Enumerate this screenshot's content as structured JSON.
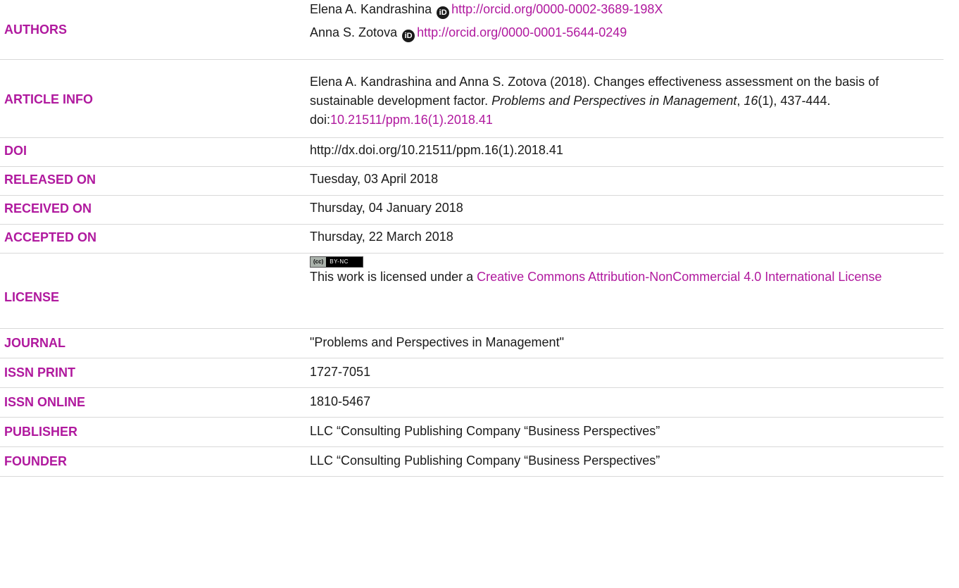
{
  "authors": {
    "label": "AUTHORS",
    "list": [
      {
        "name": "Elena A. Kandrashina",
        "orcid_url": "http://orcid.org/0000-0002-3689-198X"
      },
      {
        "name": "Anna S. Zotova",
        "orcid_url": "http://orcid.org/0000-0001-5644-0249"
      }
    ]
  },
  "article_info": {
    "label": "ARTICLE INFO",
    "citation_prefix": "Elena A. Kandrashina and Anna S. Zotova (2018). Changes effectiveness assessment on the basis of sustainable development factor. ",
    "journal_italic": "Problems and Perspectives in Management",
    "comma": ", ",
    "volume_italic": "16",
    "issue_pages": "(1), 437-444. doi:",
    "doi_link": "10.21511/ppm.16(1).2018.41"
  },
  "doi": {
    "label": "DOI",
    "value": "http://dx.doi.org/10.21511/ppm.16(1).2018.41"
  },
  "released_on": {
    "label": "RELEASED ON",
    "value": "Tuesday, 03 April 2018"
  },
  "received_on": {
    "label": "RECEIVED ON",
    "value": "Thursday, 04 January 2018"
  },
  "accepted_on": {
    "label": "ACCEPTED ON",
    "value": "Thursday, 22 March 2018"
  },
  "license": {
    "label": "LICENSE",
    "badge_cc": "(cc)",
    "badge_type": "BY-NC",
    "text_prefix": "This work is licensed under a ",
    "link_text": "Creative Commons Attribution-NonCommercial 4.0 International License"
  },
  "journal": {
    "label": "JOURNAL",
    "value": "\"Problems and Perspectives in Management\""
  },
  "issn_print": {
    "label": "ISSN PRINT",
    "value": "1727-7051"
  },
  "issn_online": {
    "label": "ISSN ONLINE",
    "value": "1810-5467"
  },
  "publisher": {
    "label": "PUBLISHER",
    "value": "LLC “Consulting Publishing Company “Business Perspectives”"
  },
  "founder": {
    "label": "FOUNDER",
    "value": "LLC “Consulting Publishing Company “Business Perspectives”"
  },
  "colors": {
    "accent": "#b0199e",
    "text": "#1a1a1a",
    "divider": "#d9d9d9"
  },
  "icons": {
    "orcid": "orcid-icon",
    "license": "cc-by-nc-badge"
  }
}
